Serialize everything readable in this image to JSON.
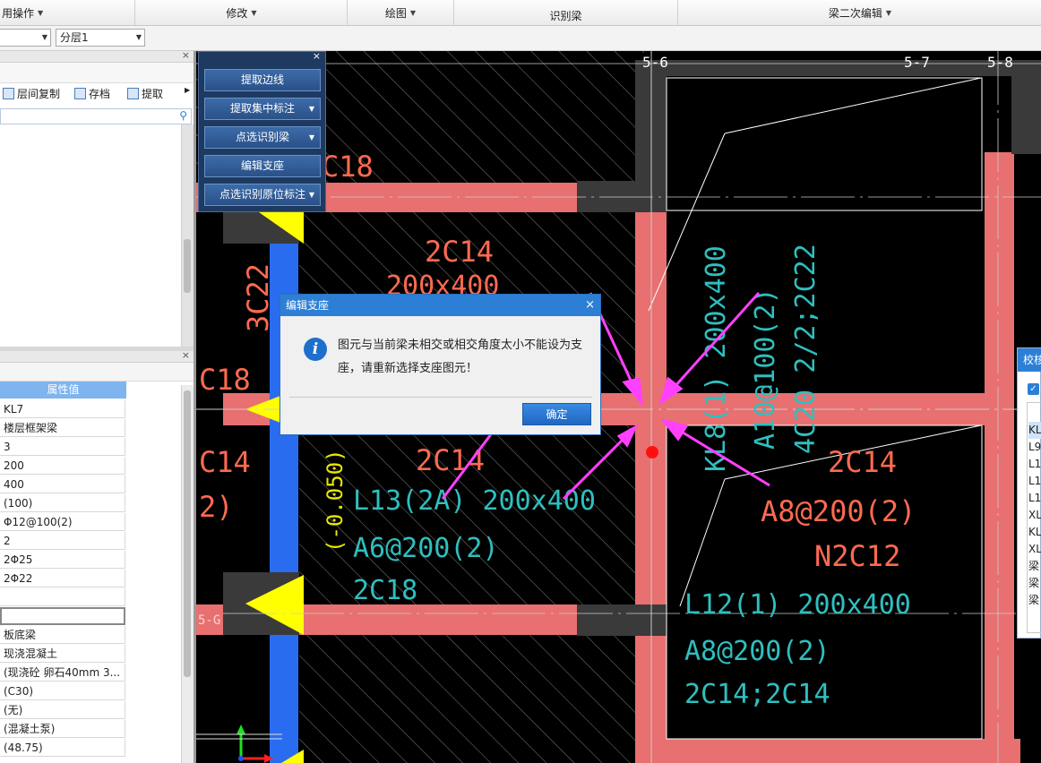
{
  "ribbon": {
    "groups": [
      {
        "label": "用操作"
      },
      {
        "label": "修改"
      },
      {
        "label": "绘图"
      },
      {
        "label": "识别梁"
      },
      {
        "label": "梁二次编辑"
      }
    ]
  },
  "toolbar": {
    "floor_combo": "",
    "layer_combo": "分层1"
  },
  "left_panel": {
    "buttons": [
      "层间复制",
      "存档",
      "提取"
    ],
    "search_placeholder": ""
  },
  "properties": {
    "header": "属性值",
    "values": [
      "KL7",
      "楼层框架梁",
      "3",
      "200",
      "400",
      "(100)",
      "Φ12@100(2)",
      "2",
      "2Φ25",
      "2Φ22",
      "",
      "",
      "板底梁",
      "现浇混凝土",
      "(现浇砼 卵石40mm 3...",
      "(C30)",
      "(无)",
      "(混凝土泵)",
      "(48.75)"
    ]
  },
  "float_panel": {
    "buttons": [
      {
        "label": "提取边线",
        "dropdown": false
      },
      {
        "label": "提取集中标注",
        "dropdown": true
      },
      {
        "label": "点选识别梁",
        "dropdown": true
      },
      {
        "label": "编辑支座",
        "dropdown": false
      },
      {
        "label": "点选识别原位标注",
        "dropdown": true
      }
    ]
  },
  "dialog": {
    "title": "编辑支座",
    "message": "图元与当前梁未相交或相交角度太小不能设为支座，请重新选择支座图元！",
    "ok_label": "确定"
  },
  "right_panel": {
    "title": "校核",
    "items": [
      "KL",
      "L9",
      "L1",
      "L1",
      "L1",
      "XL",
      "KL",
      "XL",
      "梁",
      "梁",
      "梁"
    ]
  },
  "cad": {
    "axis_labels": [
      "5-6",
      "5-7",
      "5-8",
      "5-G"
    ],
    "annotations_red": [
      "C18",
      "2C14",
      "200x400",
      "3C22",
      "C18",
      "C14",
      "2)",
      "2C14",
      "2C14",
      "A8@200(2)",
      "N2C12"
    ],
    "annotations_cyan": [
      "KL8(1) 200x400",
      "A10@100(2)",
      "4C20 2/2;2C22",
      "L13(2A) 200x400",
      "A6@200(2)",
      "2C18",
      "L12(1) 200x400",
      "A8@200(2)",
      "2C14;2C14"
    ],
    "annotations_yellow": [
      "(-0.050)"
    ],
    "colors": {
      "beam": "#e87070",
      "blue_beam": "#2a6cf0",
      "column": "#3a3a3a",
      "support": "#ffff00",
      "arrow": "#ff40ff",
      "grid": "#ffffff"
    }
  }
}
